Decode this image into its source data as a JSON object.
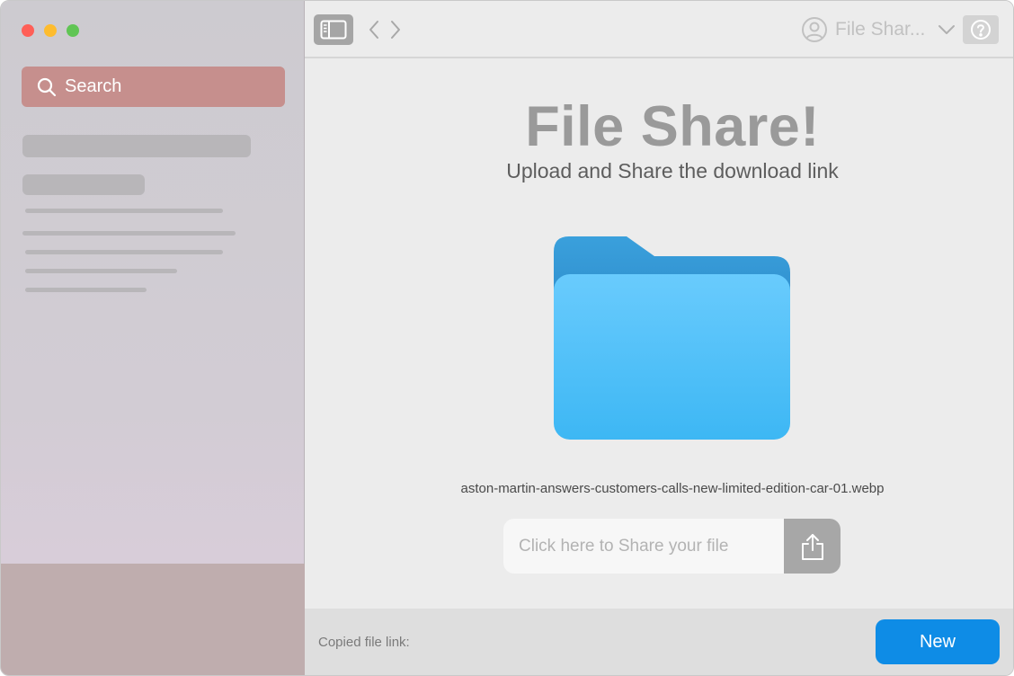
{
  "window": {
    "traffic_lights": [
      "close",
      "minimize",
      "zoom"
    ]
  },
  "sidebar": {
    "search_label": "Search",
    "search_icon": "search-icon"
  },
  "toolbar": {
    "sidebar_toggle_icon": "sidebar-icon",
    "back_icon": "chevron-left-icon",
    "forward_icon": "chevron-right-icon",
    "user_icon": "person-circle-icon",
    "user_name": "File Shar...",
    "dropdown_icon": "chevron-down-icon",
    "help_icon": "question-circle-icon"
  },
  "main": {
    "title": "File Share!",
    "subtitle": "Upload and Share the download link",
    "folder_icon": "folder-icon",
    "file_name": "aston-martin-answers-customers-calls-new-limited-edition-car-01.webp",
    "share_placeholder": "Click here to Share your file",
    "share_icon": "share-icon"
  },
  "footer": {
    "copied_label": "Copied file link:",
    "new_button": "New"
  },
  "colors": {
    "accent": "#0e8ce6",
    "search_bg": "#c68f8d",
    "folder_front": "#5cc6fb",
    "folder_back": "#2f95d6"
  }
}
